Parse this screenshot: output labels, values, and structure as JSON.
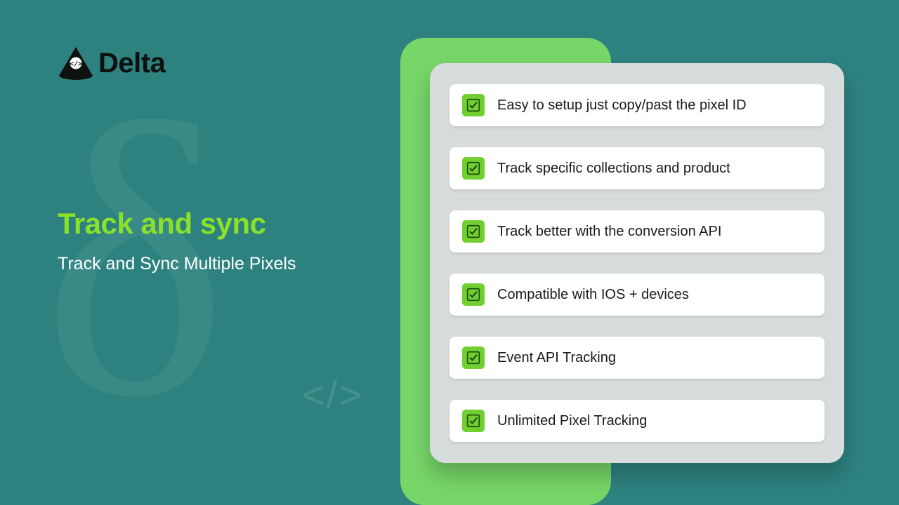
{
  "brand": {
    "name": "Delta"
  },
  "hero": {
    "headline": "Track and sync",
    "subtitle": "Track and Sync Multiple Pixels"
  },
  "features": [
    "Easy to setup just copy/past  the pixel ID",
    "Track specific collections and product",
    "Track better with the conversion API",
    "Compatible with IOS + devices",
    "Event API Tracking",
    "Unlimited Pixel Tracking"
  ],
  "colors": {
    "background": "#2d8280",
    "accent": "#8be02a",
    "card_back": "#77d668",
    "card_front": "#d7dcdc",
    "checkbox": "#71cf2f"
  }
}
